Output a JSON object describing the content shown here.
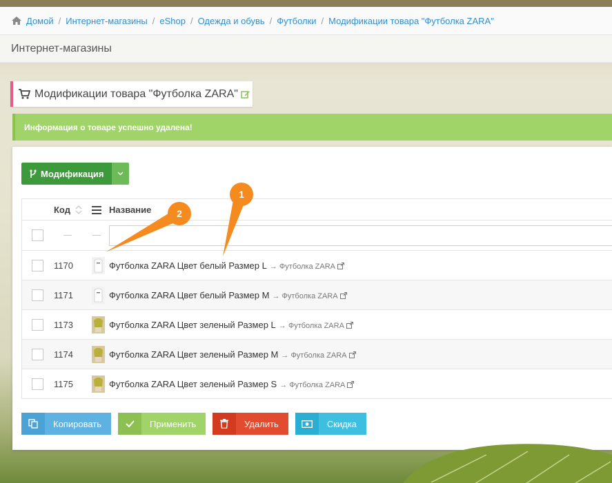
{
  "breadcrumb": {
    "items": [
      "Домой",
      "Интернет-магазины",
      "eShop",
      "Одежда и обувь",
      "Футболки",
      "Модификации товара \"Футболка ZARA\""
    ],
    "separator": "/"
  },
  "section": {
    "title": "Интернет-магазины"
  },
  "page": {
    "title": "Модификации товара \"Футболка ZARA\""
  },
  "alert": {
    "text": "Информация о товаре успешно удалена!"
  },
  "toolbar": {
    "modification_label": "Модификация"
  },
  "table": {
    "columns": {
      "code": "Код",
      "name": "Название"
    },
    "filter_placeholder": "",
    "rows": [
      {
        "code": "1170",
        "name": "Футболка ZARA Цвет белый Размер L",
        "parent": "→ Футболка ZARA",
        "thumb": "white"
      },
      {
        "code": "1171",
        "name": "Футболка ZARA Цвет белый Размер M",
        "parent": "→ Футболка ZARA",
        "thumb": "white"
      },
      {
        "code": "1173",
        "name": "Футболка ZARA Цвет зеленый Размер L",
        "parent": "→ Футболка ZARA",
        "thumb": "green"
      },
      {
        "code": "1174",
        "name": "Футболка ZARA Цвет зеленый Размер M",
        "parent": "→ Футболка ZARA",
        "thumb": "green"
      },
      {
        "code": "1175",
        "name": "Футболка ZARA Цвет зеленый Размер S",
        "parent": "→ Футболка ZARA",
        "thumb": "green"
      }
    ]
  },
  "actions": {
    "copy": "Копировать",
    "apply": "Применить",
    "delete": "Удалить",
    "discount": "Скидка"
  },
  "callouts": [
    "1",
    "2"
  ],
  "colors": {
    "link": "#2f8fd1",
    "success": "#a0d468",
    "green_button": "#3d9a3a",
    "danger": "#e24b30",
    "info": "#5db2e2",
    "callout": "#f58a1f",
    "title_accent": "#e85a88"
  }
}
